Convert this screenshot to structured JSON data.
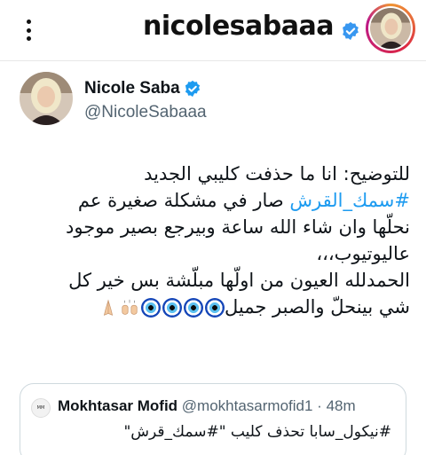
{
  "instagram": {
    "username": "nicolesabaaa",
    "verified_icon": "verified-badge-icon",
    "menu_icon": "more-vertical-icon",
    "colors": {
      "verified": "#3897f0"
    }
  },
  "tweet": {
    "author_name": "Nicole Saba",
    "author_handle": "@NicoleSabaaa",
    "verified": true,
    "body": {
      "line1": "للتوضيح: انا ما حذفت كليبي الجديد",
      "line2_hashtag": "#سمك_القرش",
      "line2_rest": " صار في مشكلة صغيرة عم",
      "line3": "نحلّها وان شاء الله ساعة وبيرجع بصير موجود",
      "line4": "عاليوتيوب،،،",
      "line5": "الحمدلله العيون من اولّها مبلّشة بس خير كل",
      "line6": "شي بينحلّ والصبر جميل"
    },
    "emojis": [
      "folded-hands",
      "raising-hands",
      "nazar-amulet",
      "nazar-amulet",
      "nazar-amulet",
      "nazar-amulet"
    ],
    "colors": {
      "hashtag": "#1d9bf0",
      "handle": "#536471",
      "verified": "#1d9bf0"
    }
  },
  "quoted_tweet": {
    "author_name": "Mokhtasar Mofid",
    "author_handle": "@mokhtasarmofid1",
    "separator": " · ",
    "time": "48m",
    "text": "#نيكول_سابا تحذف كليب \"#سمك_قرش\""
  }
}
